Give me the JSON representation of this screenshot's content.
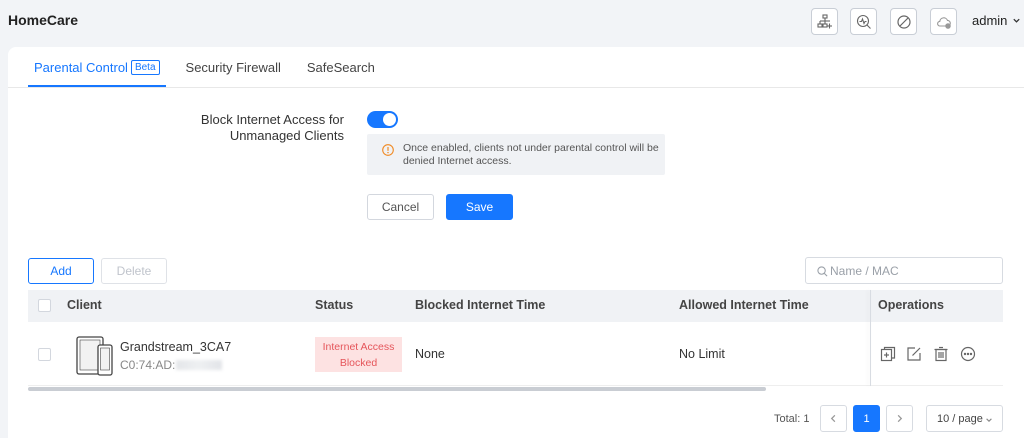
{
  "header": {
    "brand": "HomeCare",
    "user": "admin",
    "icons": [
      "network-add-icon",
      "diagnose-icon",
      "block-icon",
      "cloud-icon"
    ]
  },
  "tabs": [
    {
      "label": "Parental Control",
      "badge": "Beta",
      "active": true
    },
    {
      "label": "Security Firewall",
      "active": false
    },
    {
      "label": "SafeSearch",
      "active": false
    }
  ],
  "setting": {
    "label_line1": "Block Internet Access for",
    "label_line2": "Unmanaged Clients",
    "enabled": true,
    "notice": "Once enabled, clients not under parental control will be denied Internet access."
  },
  "form_buttons": {
    "cancel": "Cancel",
    "save": "Save"
  },
  "toolbar": {
    "add": "Add",
    "delete": "Delete",
    "search_placeholder": "Name / MAC"
  },
  "table": {
    "columns": [
      "Client",
      "Status",
      "Blocked Internet Time",
      "Allowed Internet Time",
      "Operations"
    ],
    "rows": [
      {
        "client_name": "Grandstream_3CA7",
        "client_mac": "C0:74:AD:",
        "status_line1": "Internet Access",
        "status_line2": "Blocked",
        "blocked_time": "None",
        "allowed_time": "No Limit"
      }
    ]
  },
  "pagination": {
    "total": "Total: 1",
    "current_page": "1",
    "page_size": "10 / page"
  },
  "colors": {
    "accent": "#1677ff",
    "blocked_bg": "#fde2e2",
    "blocked_text": "#e5555a"
  }
}
